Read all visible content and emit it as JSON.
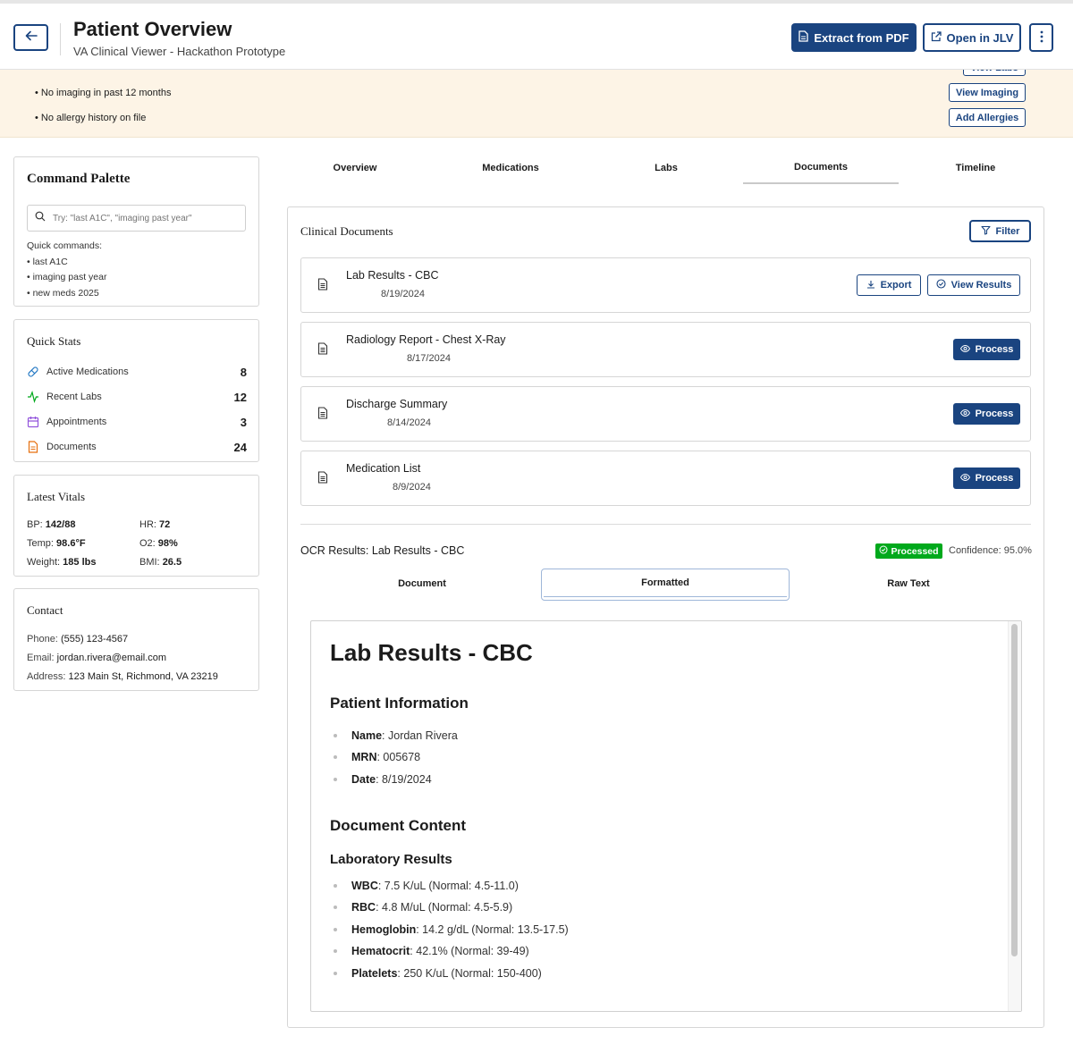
{
  "header": {
    "title": "Patient Overview",
    "subtitle": "VA Clinical Viewer - Hackathon Prototype",
    "extract_label": "Extract from PDF",
    "open_jlv_label": "Open in JLV",
    "more_icon": "vertical-dots-icon",
    "back_icon": "arrow-left-icon"
  },
  "banner": {
    "items": [
      "No imaging in past 12 months",
      "No allergy history on file"
    ],
    "partial_button": "View Labs",
    "buttons": [
      "View Imaging",
      "Add Allergies"
    ]
  },
  "command_palette": {
    "title": "Command Palette",
    "placeholder": "Try: \"last A1C\", \"imaging past year\"",
    "quick_label": "Quick commands:",
    "commands": [
      "last A1C",
      "imaging past year",
      "new meds 2025"
    ]
  },
  "quick_stats": {
    "title": "Quick Stats",
    "items": [
      {
        "label": "Active Medications",
        "value": "8",
        "icon": "pill-icon",
        "color": "#2378c3"
      },
      {
        "label": "Recent Labs",
        "value": "12",
        "icon": "activity-icon",
        "color": "#00a91c"
      },
      {
        "label": "Appointments",
        "value": "3",
        "icon": "calendar-icon",
        "color": "#9355dc"
      },
      {
        "label": "Documents",
        "value": "24",
        "icon": "document-icon",
        "color": "#e66f0e"
      }
    ]
  },
  "vitals": {
    "title": "Latest Vitals",
    "bp_label": "BP:",
    "bp": "142/88",
    "hr_label": "HR:",
    "hr": "72",
    "temp_label": "Temp:",
    "temp": "98.6°F",
    "o2_label": "O2:",
    "o2": "98%",
    "weight_label": "Weight:",
    "weight": "185 lbs",
    "bmi_label": "BMI:",
    "bmi": "26.5"
  },
  "contact": {
    "title": "Contact",
    "phone_label": "Phone:",
    "phone": "(555) 123-4567",
    "email_label": "Email:",
    "email": "jordan.rivera@email.com",
    "address_label": "Address:",
    "address": "123 Main St, Richmond, VA 23219"
  },
  "tabs": [
    "Overview",
    "Medications",
    "Labs",
    "Documents",
    "Timeline"
  ],
  "active_tab": "Documents",
  "documents": {
    "title": "Clinical Documents",
    "filter_label": "Filter",
    "export_label": "Export",
    "view_results_label": "View Results",
    "process_label": "Process",
    "rows": [
      {
        "name": "Lab Results - CBC",
        "date": "8/19/2024"
      },
      {
        "name": "Radiology Report - Chest X-Ray",
        "date": "8/17/2024"
      },
      {
        "name": "Discharge Summary",
        "date": "8/14/2024"
      },
      {
        "name": "Medication List",
        "date": "8/9/2024"
      }
    ]
  },
  "ocr": {
    "title": "OCR Results: Lab Results - CBC",
    "status": "Processed",
    "confidence": "Confidence: 95.0%",
    "subtabs": [
      "Document",
      "Formatted",
      "Raw Text"
    ],
    "active_subtab": "Formatted"
  },
  "formatted": {
    "heading": "Lab Results - CBC",
    "patient_info_heading": "Patient Information",
    "patient_info": [
      {
        "key": "Name",
        "value": ": Jordan Rivera"
      },
      {
        "key": "MRN",
        "value": ": 005678"
      },
      {
        "key": "Date",
        "value": ": 8/19/2024"
      }
    ],
    "content_heading": "Document Content",
    "lab_heading": "Laboratory Results",
    "labs": [
      {
        "key": "WBC",
        "value": ": 7.5 K/uL (Normal: 4.5-11.0)"
      },
      {
        "key": "RBC",
        "value": ": 4.8 M/uL (Normal: 4.5-5.9)"
      },
      {
        "key": "Hemoglobin",
        "value": ": 14.2 g/dL (Normal: 13.5-17.5)"
      },
      {
        "key": "Hematocrit",
        "value": ": 42.1% (Normal: 39-49)"
      },
      {
        "key": "Platelets",
        "value": ": 250 K/uL (Normal: 150-400)"
      }
    ]
  },
  "colors": {
    "primary": "#1a4480",
    "success": "#00a91c",
    "banner_bg": "#fdf4e6"
  }
}
